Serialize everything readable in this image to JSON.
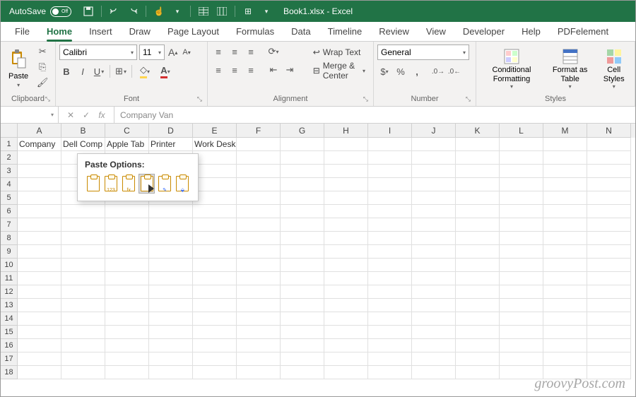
{
  "titlebar": {
    "autosave_label": "AutoSave",
    "autosave_state": "Off",
    "doc_title": "Book1.xlsx - Excel"
  },
  "tabs": [
    "File",
    "Home",
    "Insert",
    "Draw",
    "Page Layout",
    "Formulas",
    "Data",
    "Timeline",
    "Review",
    "View",
    "Developer",
    "Help",
    "PDFelement"
  ],
  "active_tab": "Home",
  "ribbon": {
    "clipboard": {
      "label": "Clipboard",
      "paste": "Paste"
    },
    "font": {
      "label": "Font",
      "font_name": "Calibri",
      "font_size": "11",
      "increase_font": "A",
      "decrease_font": "A",
      "bold": "B",
      "italic": "I",
      "underline": "U"
    },
    "alignment": {
      "label": "Alignment",
      "wrap_text": "Wrap Text",
      "merge_center": "Merge & Center"
    },
    "number": {
      "label": "Number",
      "format": "General"
    },
    "styles": {
      "label": "Styles",
      "conditional": "Conditional Formatting",
      "format_table": "Format as Table",
      "cell_styles": "Cell Styles"
    }
  },
  "formula_bar": {
    "name_box": "",
    "cancel": "✕",
    "enter": "✓",
    "fx": "fx",
    "value": "Company Van"
  },
  "columns": [
    "A",
    "B",
    "C",
    "D",
    "E",
    "F",
    "G",
    "H",
    "I",
    "J",
    "K",
    "L",
    "M",
    "N"
  ],
  "row_count": 18,
  "cells": {
    "r1": [
      "Company",
      "Dell Comp",
      "Apple Tab",
      "Printer",
      "Work Desk"
    ]
  },
  "paste_popup": {
    "title": "Paste Options:",
    "options": [
      "paste",
      "values",
      "formulas",
      "transpose",
      "formatting",
      "link"
    ],
    "labels": [
      "",
      "123",
      "fx",
      "",
      "",
      ""
    ]
  },
  "watermark": "groovyPost.com"
}
